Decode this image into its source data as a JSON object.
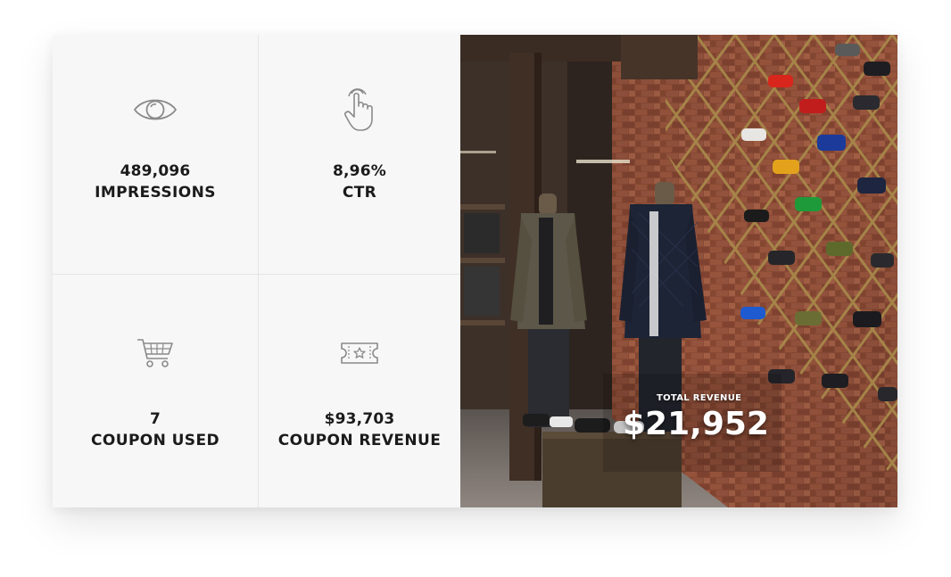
{
  "stats": {
    "impressions": {
      "value": "489,096",
      "label": "IMPRESSIONS",
      "icon": "eye-icon"
    },
    "ctr": {
      "value": "8,96%",
      "label": "CTR",
      "icon": "pointer-hand-icon"
    },
    "coupon_used": {
      "value": "7",
      "label": "COUPON USED",
      "icon": "shopping-cart-icon"
    },
    "coupon_revenue": {
      "value": "$93,703",
      "label": "COUPON REVENUE",
      "icon": "ticket-icon"
    }
  },
  "hero": {
    "revenue_label": "TOTAL REVENUE",
    "revenue_value": "$21,952"
  },
  "colors": {
    "panel_background": "#f7f7f7",
    "divider": "#e4e4e4",
    "text": "#1b1b1b",
    "icon_stroke": "#8a8a8a"
  }
}
